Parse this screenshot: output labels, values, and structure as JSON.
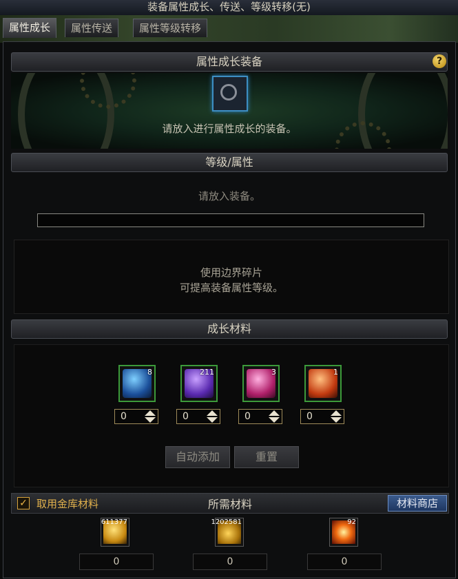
{
  "window_title": "装备属性成长、传送、等级转移(无)",
  "tabs": [
    "属性成长",
    "属性传送",
    "属性等级转移"
  ],
  "equip_section": {
    "title": "属性成长装备",
    "help": "?",
    "hint": "请放入进行属性成长的装备。"
  },
  "level_section": {
    "title": "等级/属性",
    "status": "请放入装备。",
    "progress": 0,
    "desc_line1": "使用边界碎片",
    "desc_line2": "可提高装备属性等级。"
  },
  "materials_section": {
    "title": "成长材料",
    "items": [
      {
        "icon": "blue-shard-icon",
        "count": "8",
        "qty": "0"
      },
      {
        "icon": "purple-shard-icon",
        "count": "211",
        "qty": "0"
      },
      {
        "icon": "pink-shard-icon",
        "count": "3",
        "qty": "0"
      },
      {
        "icon": "red-shard-icon",
        "count": "1",
        "qty": "0"
      }
    ],
    "auto_add": "自动添加",
    "reset": "重置"
  },
  "required_section": {
    "use_vault": "取用金库材料",
    "use_vault_checked": true,
    "title": "所需材料",
    "shop": "材料商店",
    "items": [
      {
        "icon": "gold-crystal-icon",
        "count": "611377",
        "value": "0"
      },
      {
        "icon": "gold-coins-icon",
        "count": "1202581",
        "value": "0"
      },
      {
        "icon": "fire-burst-icon",
        "count": "92",
        "value": "0"
      }
    ]
  },
  "colors": {
    "accent_gold": "#d9a43b",
    "slot_green": "#3c9a3a",
    "slot_blue": "#3d8fc4",
    "shop_blue": "#1e3660"
  }
}
